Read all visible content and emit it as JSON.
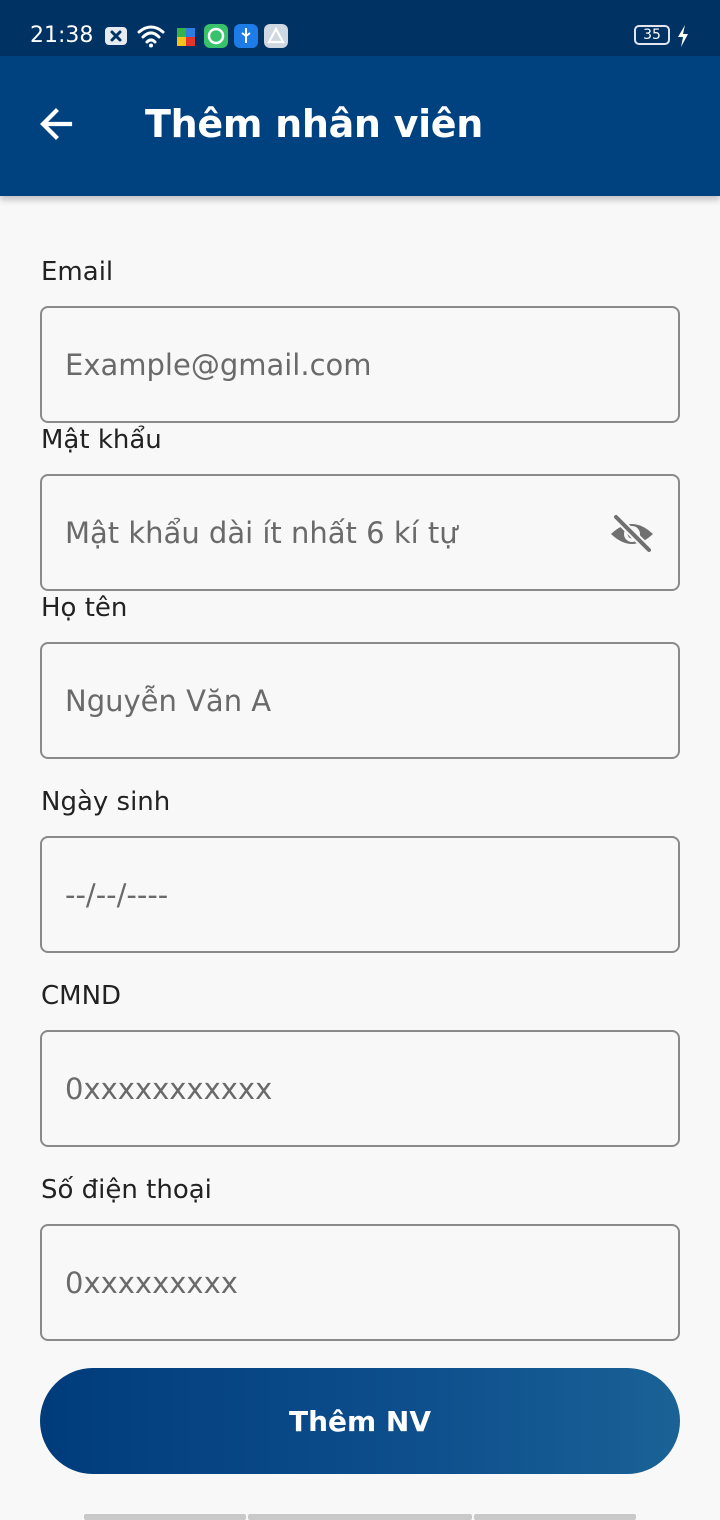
{
  "status_bar": {
    "time": "21:38",
    "battery": "35"
  },
  "app_bar": {
    "title": "Thêm nhân viên"
  },
  "form": {
    "email": {
      "label": "Email",
      "placeholder": "Example@gmail.com",
      "value": ""
    },
    "password": {
      "label": "Mật khẩu",
      "placeholder": "Mật khẩu dài ít nhất 6 kí tự",
      "value": ""
    },
    "full_name": {
      "label": "Họ tên",
      "placeholder": "Nguyễn Văn A",
      "value": ""
    },
    "birthday": {
      "label": "Ngày sinh",
      "placeholder": "--/--/----",
      "value": ""
    },
    "id_card": {
      "label": "CMND",
      "placeholder": "0xxxxxxxxxxx",
      "value": ""
    },
    "phone": {
      "label": "Số điện thoại",
      "placeholder": "0xxxxxxxxx",
      "value": ""
    },
    "submit_label": "Thêm NV"
  },
  "colors": {
    "status_bar": "#003264",
    "app_bar": "#004280",
    "button_start": "#003c7c",
    "button_end": "#1a6296",
    "field_border": "#8a8a8a",
    "background": "#f8f8f8"
  },
  "icons": {
    "back": "arrow-left",
    "password_toggle": "eye-off",
    "status": [
      "x-notification",
      "wifi",
      "puzzle",
      "leaf",
      "usb",
      "drive",
      "battery",
      "charging-bolt"
    ]
  }
}
